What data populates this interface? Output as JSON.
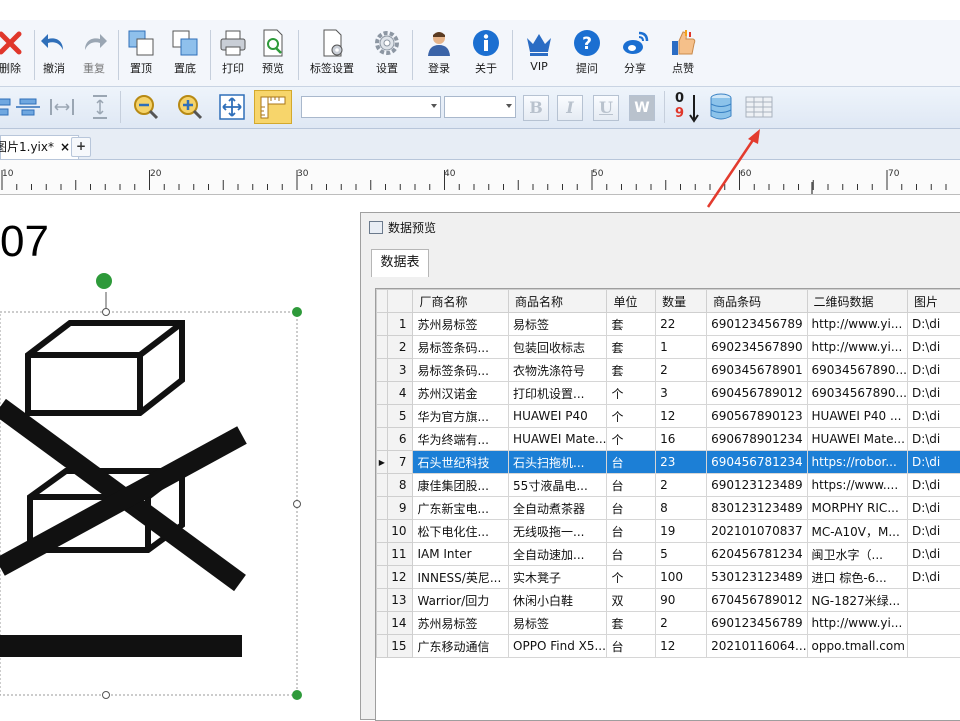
{
  "toolbar1": {
    "items": [
      {
        "label": "删除",
        "icon": "delete-icon"
      },
      {
        "label": "撤消",
        "icon": "undo-icon"
      },
      {
        "label": "重复",
        "icon": "redo-icon"
      },
      {
        "label": "置顶",
        "icon": "bring-to-front-icon"
      },
      {
        "label": "置底",
        "icon": "send-to-back-icon"
      },
      {
        "label": "打印",
        "icon": "print-icon"
      },
      {
        "label": "预览",
        "icon": "preview-icon"
      },
      {
        "label": "标签设置",
        "icon": "label-settings-icon"
      },
      {
        "label": "设置",
        "icon": "settings-gear-icon"
      },
      {
        "label": "登录",
        "icon": "login-user-icon"
      },
      {
        "label": "关于",
        "icon": "about-info-icon"
      },
      {
        "label": "VIP",
        "icon": "vip-crown-icon"
      },
      {
        "label": "提问",
        "icon": "question-icon"
      },
      {
        "label": "分享",
        "icon": "weibo-share-icon"
      },
      {
        "label": "点赞",
        "icon": "thumbs-up-icon"
      }
    ]
  },
  "toolbar2": {
    "format_buttons": [
      "B",
      "I",
      "U",
      "W"
    ],
    "sort_digits": [
      "0",
      "9"
    ]
  },
  "document": {
    "tab_label": "图片1.yix*",
    "close_label": "×",
    "add_label": "+"
  },
  "ruler": {
    "labels": [
      "10",
      "20",
      "30",
      "40",
      "50",
      "60",
      "70"
    ]
  },
  "canvas": {
    "label_number": "07"
  },
  "panel": {
    "title": "数据预览",
    "sheet_tab": "数据表",
    "columns": [
      "厂商名称",
      "商品名称",
      "单位",
      "数量",
      "商品条码",
      "二维码数据",
      "图片"
    ],
    "selected_row": 7,
    "rows": [
      {
        "n": "1",
        "c": [
          "苏州易标签",
          "易标签",
          "套",
          "22",
          "690123456789",
          "http://www.yi...",
          "D:\\di"
        ]
      },
      {
        "n": "2",
        "c": [
          "易标签条码...",
          "包装回收标志",
          "套",
          "1",
          "690234567890",
          "http://www.yi...",
          "D:\\di"
        ]
      },
      {
        "n": "3",
        "c": [
          "易标签条码...",
          "衣物洗涤符号",
          "套",
          "2",
          "690345678901",
          "69034567890...",
          "D:\\di"
        ]
      },
      {
        "n": "4",
        "c": [
          "苏州汉诺金",
          "打印机设置...",
          "个",
          "3",
          "690456789012",
          "69034567890...",
          "D:\\di"
        ]
      },
      {
        "n": "5",
        "c": [
          "华为官方旗...",
          "HUAWEI P40",
          "个",
          "12",
          "690567890123",
          "HUAWEI P40 ...",
          "D:\\di"
        ]
      },
      {
        "n": "6",
        "c": [
          "华为终端有...",
          "HUAWEI Mate...",
          "个",
          "16",
          "690678901234",
          "HUAWEI Mate...",
          "D:\\di"
        ]
      },
      {
        "n": "7",
        "c": [
          "石头世纪科技",
          "石头扫拖机...",
          "台",
          "23",
          "690456781234",
          "https://robor...",
          "D:\\di"
        ]
      },
      {
        "n": "8",
        "c": [
          "康佳集团股...",
          "55寸液晶电...",
          "台",
          "2",
          "690123123489",
          "https://www....",
          "D:\\di"
        ]
      },
      {
        "n": "9",
        "c": [
          "广东新宝电...",
          "全自动煮茶器",
          "台",
          "8",
          "830123123489",
          "MORPHY RIC...",
          "D:\\di"
        ]
      },
      {
        "n": "10",
        "c": [
          "松下电化住...",
          "无线吸拖一...",
          "台",
          "19",
          "202101070837",
          "MC-A10V，M...",
          "D:\\di"
        ]
      },
      {
        "n": "11",
        "c": [
          "IAM Inter",
          "全自动速加...",
          "台",
          "5",
          "620456781234",
          "闽卫水字（...",
          "D:\\di"
        ]
      },
      {
        "n": "12",
        "c": [
          "INNESS/英尼...",
          "实木凳子",
          "个",
          "100",
          "530123123489",
          "进口 棕色-6...",
          "D:\\di"
        ]
      },
      {
        "n": "13",
        "c": [
          "Warrior/回力",
          "休闲小白鞋",
          "双",
          "90",
          "670456789012",
          "NG-1827米绿...",
          ""
        ]
      },
      {
        "n": "14",
        "c": [
          "苏州易标签",
          "易标签",
          "套",
          "2",
          "690123456789",
          "http://www.yi...",
          ""
        ]
      },
      {
        "n": "15",
        "c": [
          "广东移动通信",
          "OPPO Find X5...",
          "台",
          "12",
          "20210116064...",
          "oppo.tmall.com",
          ""
        ]
      }
    ]
  },
  "colors": {
    "selection": "#1c7fd6",
    "accent": "#1a73c9",
    "arrow": "#e33b2e"
  }
}
